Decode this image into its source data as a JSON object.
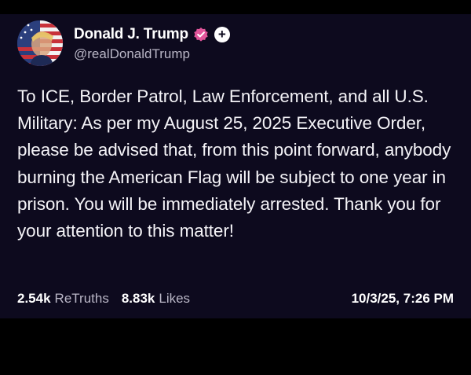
{
  "post": {
    "author": {
      "display_name": "Donald J. Trump",
      "handle": "@realDonaldTrump",
      "verified_badge_color": "#e0559a",
      "avatar_icon": "flag-portrait-avatar"
    },
    "follow_icon": "+",
    "text": "To ICE, Border Patrol, Law Enforcement, and all U.S. Military: As per my August 25, 2025 Executive Order, please be advised that, from this point forward, anybody burning the American Flag will be subject to one year in prison. You will be immediately arrested. Thank you for your attention to this matter!",
    "stats": {
      "retruths_count": "2.54k",
      "retruths_label": "ReTruths",
      "likes_count": "8.83k",
      "likes_label": "Likes"
    },
    "timestamp": "10/3/25, 7:26 PM"
  },
  "colors": {
    "page_background": "#000000",
    "card_background": "#0d0a1e",
    "primary_text": "#f4f3f7",
    "secondary_text": "#b9b6c6"
  }
}
